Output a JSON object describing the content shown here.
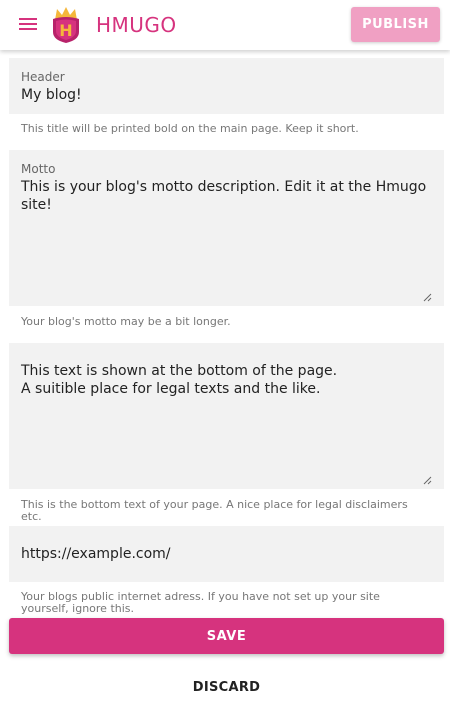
{
  "appbar": {
    "title": "HMUGO",
    "menu_icon": "hamburger-menu-icon",
    "logo_letter": "H",
    "publish_label": "PUBLISH"
  },
  "colors": {
    "accent": "#d6337e",
    "accent_light": "#f0a0c3",
    "field_bg": "#f2f2f2",
    "logo_gold": "#f5b73b",
    "logo_magenta": "#b8226a"
  },
  "form": {
    "header": {
      "label": "Header",
      "value": "My blog!",
      "helper": "This title will be printed bold on the main page. Keep it short."
    },
    "motto": {
      "label": "Motto",
      "value": "This is your blog's motto description. Edit it at the Hmugo site!",
      "helper": "Your blog's motto may be a bit longer."
    },
    "footer": {
      "value": "This text is shown at the bottom of the page.\nA suitible place for legal texts and the like.",
      "helper": "This is the bottom text of your page. A nice place for legal disclaimers etc."
    },
    "url": {
      "value": "https://example.com/",
      "helper": "Your blogs public internet adress. If you have not set up your site yourself, ignore this."
    }
  },
  "actions": {
    "save_label": "SAVE",
    "discard_label": "DISCARD"
  }
}
